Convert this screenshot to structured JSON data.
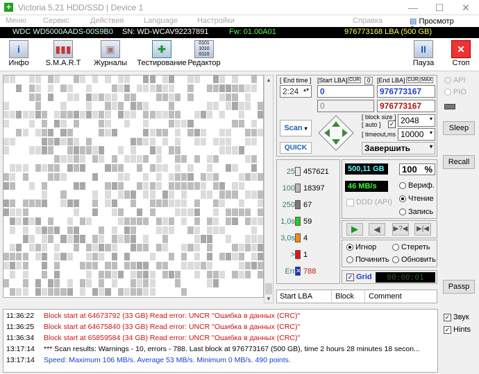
{
  "window": {
    "title": "Victoria 5.21 HDD/SSD | Device 1",
    "minimize": "—",
    "maximize": "☐",
    "close": "✕"
  },
  "menu": [
    "Меню",
    "Сервис",
    "Действия",
    "Language",
    "Настройки",
    "Справка"
  ],
  "menu_right": "Просмотр буфера",
  "drive": {
    "model": "WDC WD5000AADS-00S9B0",
    "serial": "SN: WD-WCAV92237891",
    "firmware": "Fw: 01.00A01",
    "capacity": "976773168 LBA (500 GB)"
  },
  "toolbar": {
    "info": "Инфо",
    "smart": "S.M.A.R.T",
    "logs": "Журналы",
    "testing": "Тестирование",
    "editor": "Редактор",
    "pause": "Пауза",
    "stop": "Стоп"
  },
  "test": {
    "end_time_label": "End time",
    "end_time": "2:24",
    "start_lba_label": "Start LBA",
    "cur_label": "CUR",
    "cur_value": "0",
    "end_lba_label": "End LBA",
    "max_label": "MAX",
    "start_lba": "0",
    "end_lba": "976773167",
    "start_lba2": "0",
    "end_lba2": "976773167",
    "block_size_label": "block size",
    "auto_label": "auto",
    "block_size": "2048",
    "timeout_label": "timeout,ms",
    "timeout": "10000",
    "scan_button": "Scan",
    "quick_button": "QUICK",
    "finish_select": "Завершить"
  },
  "stats": {
    "legend": [
      {
        "label": "25",
        "count": "457621",
        "color": "#e6e6e6"
      },
      {
        "label": "100",
        "count": "18397",
        "color": "#b8b8b8"
      },
      {
        "label": "250",
        "count": "67",
        "color": "#7a7a7a"
      },
      {
        "label": "1,0s",
        "count": "59",
        "color": "#22cc22"
      },
      {
        "label": "3,0s",
        "count": "4",
        "color": "#ff8800"
      },
      {
        "label": ">",
        "count": "1",
        "color": "#ee1111"
      },
      {
        "label": "Err",
        "count": "788",
        "color": "#1133cc"
      }
    ],
    "scanned": "500,11 GB",
    "percent": "100",
    "percent_unit": "%",
    "speed": "46 MB/s",
    "ddd_label": "DDD (API)",
    "verify": "Вериф.",
    "read": "Чтение",
    "write": "Запись",
    "ignore": "Игнор",
    "erase": "Стереть",
    "repair": "Починить",
    "refresh": "Обновить",
    "grid_label": "Grid",
    "timer": "00:00:01"
  },
  "table_headers": [
    "Start LBA",
    "Block",
    "Comment"
  ],
  "side": {
    "api": "API",
    "pio": "PIO",
    "sleep": "Sleep",
    "recall": "Recall",
    "passp": "Passp",
    "sound": "Звук",
    "hints": "Hints"
  },
  "log": [
    {
      "time": "11:36:22",
      "text": "Block start at 64673792 (33 GB) Read error: UNCR \"Ошибка в данных (CRC)\"",
      "color": "#cc1111"
    },
    {
      "time": "11:36:25",
      "text": "Block start at 64675840 (33 GB) Read error: UNCR \"Ошибка в данных (CRC)\"",
      "color": "#cc1111"
    },
    {
      "time": "11:36:34",
      "text": "Block start at 65859584 (34 GB) Read error: UNCR \"Ошибка в данных (CRC)\"",
      "color": "#cc1111"
    },
    {
      "time": "13:17:14",
      "text": "*** Scan results: Warnings - 10, errors - 788. Last block at 976773167 (500 GB), time 2 hours 28 minutes 18 secon...",
      "color": "#000000"
    },
    {
      "time": "13:17:14",
      "text": "Speed: Maximum 106 MB/s. Average 53 MB/s. Minimum 0 MB/s. 490 points.",
      "color": "#1a3fcc"
    }
  ]
}
